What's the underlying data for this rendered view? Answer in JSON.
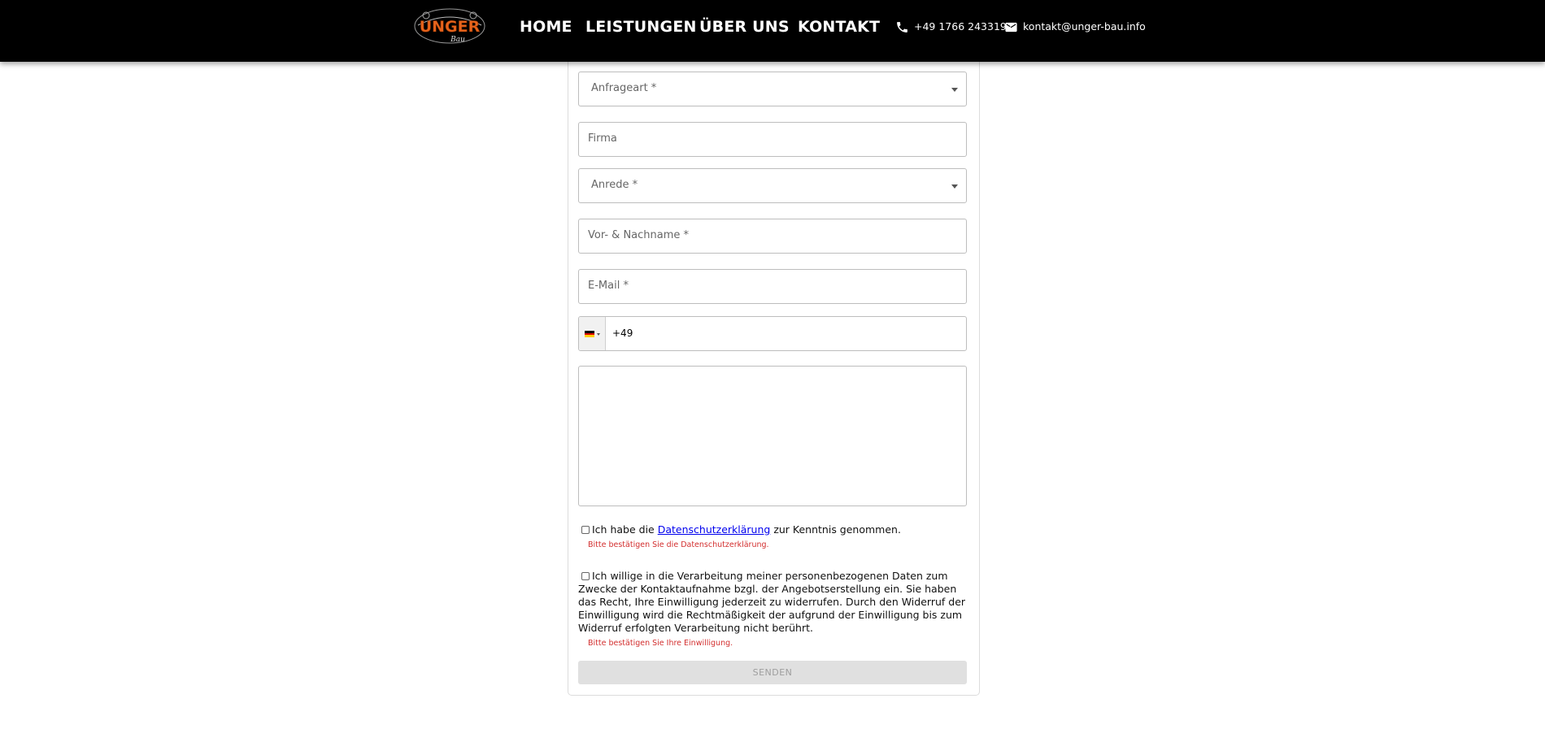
{
  "header": {
    "logo_text": "UNGER",
    "logo_sub": "Bau",
    "nav": [
      "HOME",
      "LEISTUNGEN",
      "ÜBER UNS",
      "KONTAKT"
    ],
    "phone": "+49 1766 2433192",
    "email": "kontakt@unger-bau.info"
  },
  "form": {
    "inquiry_type_placeholder": "Anfrageart *",
    "company_placeholder": "Firma",
    "salutation_placeholder": "Anrede *",
    "name_placeholder": "Vor- & Nachname *",
    "email_placeholder": "E-Mail *",
    "phone_value": "+49",
    "privacy_prefix": "Ich habe die ",
    "privacy_link": "Datenschutzerklärung",
    "privacy_suffix": " zur Kenntnis genommen.",
    "privacy_error": "Bitte bestätigen Sie die Datenschutzerklärung.",
    "consent_text": "Ich willige in die Verarbeitung meiner personenbezogenen Daten zum Zwecke der Kontaktaufnahme bzgl. der Angebotserstellung ein. Sie haben das Recht, Ihre Einwilligung jederzeit zu widerrufen. Durch den Widerruf der Einwilligung wird die Rechtmäßigkeit der aufgrund der Einwilligung bis zum Widerruf erfolgten Verarbeitung nicht berührt.",
    "consent_error": "Bitte bestätigen Sie Ihre Einwilligung.",
    "submit_label": "SENDEN"
  },
  "colors": {
    "header_bg": "#000000",
    "logo_orange": "#e8641c",
    "error_red": "#d32f2f",
    "link_blue": "#0000ee"
  },
  "icons": [
    "phone-icon",
    "mail-icon",
    "germany-flag-icon",
    "chevron-down-icon"
  ]
}
